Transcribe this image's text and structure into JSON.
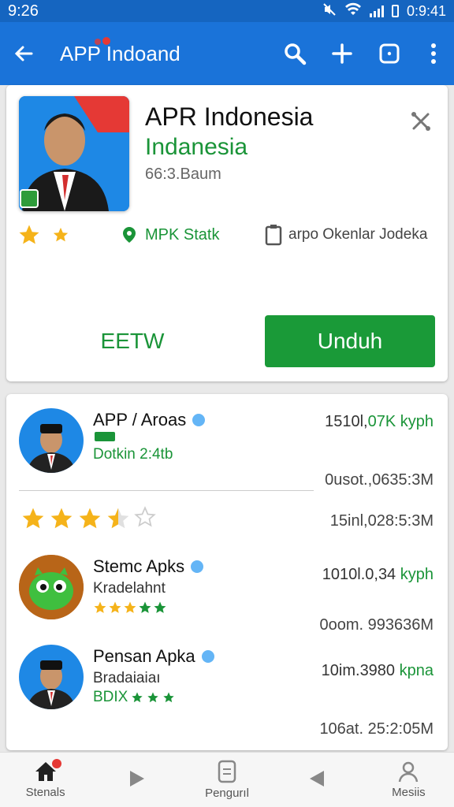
{
  "status_bar": {
    "time": "9:26",
    "right_time": "0:9:41"
  },
  "app_bar": {
    "title": "APP Indoand"
  },
  "app_detail": {
    "name": "APR Indonesia",
    "developer": "Indanesia",
    "size": "66:3.Baum",
    "meta_tag": "MPK Statk",
    "meta_info": "arpo Okenlar Jodeka",
    "secondary_button": "EETW",
    "primary_button": "Unduh"
  },
  "list": [
    {
      "title": "APP / Aroas",
      "subtitle": "Dotkin 2:4tb",
      "right_top_a": "1510l,",
      "right_top_b": "07K kyph",
      "right_bottom": "0usot.,0635:3M",
      "rating_stars": 3.5
    },
    {
      "title": "",
      "subtitle": "",
      "right_top_a": "15inl,028:5:3M",
      "right_top_b": "",
      "right_bottom": ""
    },
    {
      "title": "Stemc Apks",
      "subtitle": "Kradelahnt",
      "right_top_a": "1010l.0,34",
      "right_top_b": "kyph",
      "right_bottom": "0oom. 993636M"
    },
    {
      "title": "Pensan Apka",
      "subtitle": "Bradaiaiaı",
      "subtitle2": "BDIX",
      "right_top_a": "10im.3980",
      "right_top_b": "kpnа",
      "right_bottom": "106at. 25:2:05M"
    }
  ],
  "bottom_nav": [
    "Stenals",
    "",
    "Pengurıl",
    "",
    "Mesiis"
  ],
  "colors": {
    "app_bar": "#1a73d9",
    "accent_green": "#1a9a38",
    "star": "#f5b31a"
  }
}
